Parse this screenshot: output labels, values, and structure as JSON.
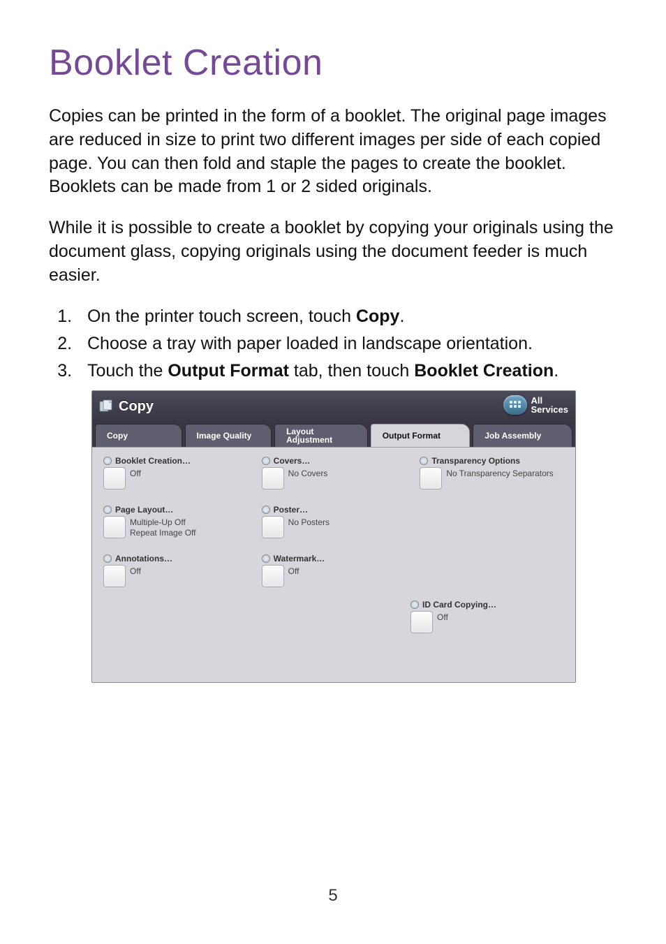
{
  "document": {
    "title": "Booklet Creation",
    "paragraph1": "Copies can be printed in the form of a booklet. The original page images are reduced in size to print two different images per side of each copied page. You can then fold and staple the pages to create the booklet. Booklets can be made from 1 or 2 sided originals.",
    "paragraph2": "While it is possible to create a booklet by copying your originals using the document glass, copying originals using the document feeder is much easier.",
    "steps": {
      "s1a": "On the printer touch screen, touch ",
      "s1b": "Copy",
      "s1c": ".",
      "s2": "Choose a tray with paper loaded in landscape orientation.",
      "s3a": "Touch the ",
      "s3b": "Output Format",
      "s3c": " tab, then touch ",
      "s3d": "Booklet Creation",
      "s3e": "."
    },
    "page_number": "5"
  },
  "screenshot": {
    "header_title": "Copy",
    "all_services_line1": "All",
    "all_services_line2": "Services",
    "tabs": {
      "copy": "Copy",
      "image_quality": "Image Quality",
      "layout_adj_line1": "Layout",
      "layout_adj_line2": "Adjustment",
      "output_format": "Output Format",
      "job_assembly": "Job Assembly"
    },
    "options": {
      "booklet": {
        "title": "Booklet Creation…",
        "value": "Off"
      },
      "covers": {
        "title": "Covers…",
        "value": "No Covers"
      },
      "transparency": {
        "title": "Transparency Options",
        "value": "No Transparency Separators"
      },
      "page_layout": {
        "title": "Page Layout…",
        "value_line1": "Multiple-Up Off",
        "value_line2": "Repeat Image Off"
      },
      "poster": {
        "title": "Poster…",
        "value": "No Posters"
      },
      "annotations": {
        "title": "Annotations…",
        "value": "Off"
      },
      "watermark": {
        "title": "Watermark…",
        "value": "Off"
      },
      "id_card": {
        "title": "ID Card Copying…",
        "value": "Off"
      }
    }
  }
}
